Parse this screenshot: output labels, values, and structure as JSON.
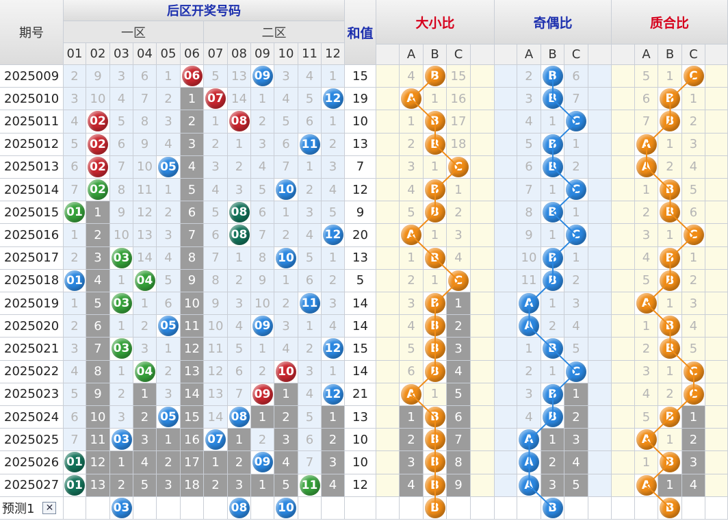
{
  "header": {
    "period_label": "期号",
    "draw_title": "后区开奖号码",
    "zone1_label": "一区",
    "zone2_label": "二区",
    "sum_label": "和值",
    "size_ratio_label": "大小比",
    "odd_even_label": "奇偶比",
    "prime_label": "质合比",
    "numbers": [
      "01",
      "02",
      "03",
      "04",
      "05",
      "06",
      "07",
      "08",
      "09",
      "10",
      "11",
      "12"
    ],
    "abc": [
      "A",
      "B",
      "C"
    ]
  },
  "colors": {
    "red_ball": "#c8272f",
    "blue_ball": "#2b87e0",
    "green_ball": "#36a13a",
    "dark_green_ball": "#137259",
    "orange_ball": "#f08c16",
    "gray_cell": "#9c9c9c",
    "line_orange": "#f08c16",
    "line_blue": "#2b87e0"
  },
  "rows": [
    {
      "period": "2025009",
      "cells": [
        "2",
        "9",
        "3",
        "6",
        "1",
        "06",
        "5",
        "13",
        "09",
        "3",
        "4",
        "1"
      ],
      "hits": {
        "6": "red",
        "9": "blue"
      },
      "gray": [],
      "sum": "15",
      "size": [
        "4",
        "B",
        "15"
      ],
      "size_hit": 1,
      "size_gray": [],
      "oe": [
        "2",
        "B",
        "6"
      ],
      "oe_hit": 1,
      "oe_gray": [],
      "pc": [
        "5",
        "1",
        "C"
      ],
      "pc_hit": 2,
      "pc_gray": []
    },
    {
      "period": "2025010",
      "cells": [
        "3",
        "10",
        "4",
        "7",
        "2",
        "1",
        "07",
        "14",
        "1",
        "4",
        "5",
        "12"
      ],
      "hits": {
        "7": "red",
        "12": "blue"
      },
      "gray": [
        6
      ],
      "sum": "19",
      "size": [
        "A",
        "1",
        "16"
      ],
      "size_hit": 0,
      "size_gray": [],
      "oe": [
        "3",
        "B",
        "7"
      ],
      "oe_hit": 1,
      "oe_gray": [],
      "pc": [
        "6",
        "B",
        "1"
      ],
      "pc_hit": 1,
      "pc_gray": []
    },
    {
      "period": "2025011",
      "cells": [
        "4",
        "02",
        "5",
        "8",
        "3",
        "2",
        "1",
        "08",
        "2",
        "5",
        "6",
        "1"
      ],
      "hits": {
        "2": "red",
        "8": "red"
      },
      "gray": [
        6
      ],
      "sum": "10",
      "size": [
        "1",
        "B",
        "17"
      ],
      "size_hit": 1,
      "size_gray": [],
      "oe": [
        "4",
        "1",
        "C"
      ],
      "oe_hit": 2,
      "oe_gray": [],
      "pc": [
        "7",
        "B",
        "2"
      ],
      "pc_hit": 1,
      "pc_gray": []
    },
    {
      "period": "2025012",
      "cells": [
        "5",
        "02",
        "6",
        "9",
        "4",
        "3",
        "2",
        "1",
        "3",
        "6",
        "11",
        "2"
      ],
      "hits": {
        "2": "red",
        "11": "blue"
      },
      "gray": [
        6
      ],
      "sum": "13",
      "size": [
        "2",
        "B",
        "18"
      ],
      "size_hit": 1,
      "size_gray": [],
      "oe": [
        "5",
        "B",
        "1"
      ],
      "oe_hit": 1,
      "oe_gray": [],
      "pc": [
        "A",
        "1",
        "3"
      ],
      "pc_hit": 0,
      "pc_gray": []
    },
    {
      "period": "2025013",
      "cells": [
        "6",
        "02",
        "7",
        "10",
        "05",
        "4",
        "3",
        "2",
        "4",
        "7",
        "1",
        "3"
      ],
      "hits": {
        "2": "red",
        "5": "blue"
      },
      "gray": [
        6
      ],
      "sum": "7",
      "size": [
        "3",
        "1",
        "C"
      ],
      "size_hit": 2,
      "size_gray": [],
      "oe": [
        "6",
        "B",
        "2"
      ],
      "oe_hit": 1,
      "oe_gray": [],
      "pc": [
        "A",
        "2",
        "4"
      ],
      "pc_hit": 0,
      "pc_gray": []
    },
    {
      "period": "2025014",
      "cells": [
        "7",
        "02",
        "8",
        "11",
        "1",
        "5",
        "4",
        "3",
        "5",
        "10",
        "2",
        "4"
      ],
      "hits": {
        "2": "green",
        "10": "blue"
      },
      "gray": [
        6
      ],
      "sum": "12",
      "size": [
        "4",
        "B",
        "1"
      ],
      "size_hit": 1,
      "size_gray": [],
      "oe": [
        "7",
        "1",
        "C"
      ],
      "oe_hit": 2,
      "oe_gray": [],
      "pc": [
        "1",
        "B",
        "5"
      ],
      "pc_hit": 1,
      "pc_gray": []
    },
    {
      "period": "2025015",
      "cells": [
        "01",
        "1",
        "9",
        "12",
        "2",
        "6",
        "5",
        "08",
        "6",
        "1",
        "3",
        "5"
      ],
      "hits": {
        "1": "green",
        "8": "dgreen"
      },
      "gray": [
        2,
        6
      ],
      "sum": "9",
      "size": [
        "5",
        "B",
        "2"
      ],
      "size_hit": 1,
      "size_gray": [],
      "oe": [
        "8",
        "B",
        "1"
      ],
      "oe_hit": 1,
      "oe_gray": [],
      "pc": [
        "2",
        "B",
        "6"
      ],
      "pc_hit": 1,
      "pc_gray": []
    },
    {
      "period": "2025016",
      "cells": [
        "1",
        "2",
        "10",
        "13",
        "3",
        "7",
        "6",
        "08",
        "7",
        "2",
        "4",
        "12"
      ],
      "hits": {
        "8": "dgreen",
        "12": "blue"
      },
      "gray": [
        2,
        6
      ],
      "sum": "20",
      "size": [
        "A",
        "1",
        "3"
      ],
      "size_hit": 0,
      "size_gray": [],
      "oe": [
        "9",
        "1",
        "C"
      ],
      "oe_hit": 2,
      "oe_gray": [],
      "pc": [
        "3",
        "1",
        "C"
      ],
      "pc_hit": 2,
      "pc_gray": []
    },
    {
      "period": "2025017",
      "cells": [
        "2",
        "3",
        "03",
        "14",
        "4",
        "8",
        "7",
        "1",
        "8",
        "10",
        "5",
        "1"
      ],
      "hits": {
        "3": "green",
        "10": "blue"
      },
      "gray": [
        2,
        6
      ],
      "sum": "13",
      "size": [
        "1",
        "B",
        "4"
      ],
      "size_hit": 1,
      "size_gray": [],
      "oe": [
        "10",
        "B",
        "1"
      ],
      "oe_hit": 1,
      "oe_gray": [],
      "pc": [
        "4",
        "B",
        "1"
      ],
      "pc_hit": 1,
      "pc_gray": []
    },
    {
      "period": "2025018",
      "cells": [
        "01",
        "4",
        "1",
        "04",
        "5",
        "9",
        "8",
        "2",
        "9",
        "1",
        "6",
        "2"
      ],
      "hits": {
        "1": "blue",
        "4": "green"
      },
      "gray": [
        2,
        6
      ],
      "sum": "5",
      "size": [
        "2",
        "1",
        "C"
      ],
      "size_hit": 2,
      "size_gray": [],
      "oe": [
        "11",
        "B",
        "2"
      ],
      "oe_hit": 1,
      "oe_gray": [],
      "pc": [
        "5",
        "B",
        "2"
      ],
      "pc_hit": 1,
      "pc_gray": []
    },
    {
      "period": "2025019",
      "cells": [
        "1",
        "5",
        "03",
        "1",
        "6",
        "10",
        "9",
        "3",
        "10",
        "2",
        "11",
        "3"
      ],
      "hits": {
        "3": "green",
        "11": "blue"
      },
      "gray": [
        2,
        6
      ],
      "sum": "14",
      "size": [
        "3",
        "B",
        "1"
      ],
      "size_hit": 1,
      "size_gray": [
        2
      ],
      "oe": [
        "A",
        "1",
        "3"
      ],
      "oe_hit": 0,
      "oe_gray": [],
      "pc": [
        "A",
        "1",
        "3"
      ],
      "pc_hit": 0,
      "pc_gray": []
    },
    {
      "period": "2025020",
      "cells": [
        "2",
        "6",
        "1",
        "2",
        "05",
        "11",
        "10",
        "4",
        "09",
        "3",
        "1",
        "4"
      ],
      "hits": {
        "5": "blue",
        "9": "blue"
      },
      "gray": [
        2,
        6
      ],
      "sum": "14",
      "size": [
        "4",
        "B",
        "2"
      ],
      "size_hit": 1,
      "size_gray": [
        2
      ],
      "oe": [
        "A",
        "2",
        "4"
      ],
      "oe_hit": 0,
      "oe_gray": [],
      "pc": [
        "1",
        "B",
        "4"
      ],
      "pc_hit": 1,
      "pc_gray": []
    },
    {
      "period": "2025021",
      "cells": [
        "3",
        "7",
        "03",
        "3",
        "1",
        "12",
        "11",
        "5",
        "1",
        "4",
        "2",
        "12"
      ],
      "hits": {
        "3": "green",
        "12": "blue"
      },
      "gray": [
        2,
        6
      ],
      "sum": "15",
      "size": [
        "5",
        "B",
        "3"
      ],
      "size_hit": 1,
      "size_gray": [
        2
      ],
      "oe": [
        "1",
        "B",
        "5"
      ],
      "oe_hit": 1,
      "oe_gray": [],
      "pc": [
        "2",
        "B",
        "5"
      ],
      "pc_hit": 1,
      "pc_gray": []
    },
    {
      "period": "2025022",
      "cells": [
        "4",
        "8",
        "1",
        "04",
        "2",
        "13",
        "12",
        "6",
        "2",
        "10",
        "3",
        "1"
      ],
      "hits": {
        "4": "green",
        "10": "red"
      },
      "gray": [
        2,
        6
      ],
      "sum": "14",
      "size": [
        "6",
        "B",
        "4"
      ],
      "size_hit": 1,
      "size_gray": [
        2
      ],
      "oe": [
        "2",
        "1",
        "C"
      ],
      "oe_hit": 2,
      "oe_gray": [],
      "pc": [
        "3",
        "1",
        "C"
      ],
      "pc_hit": 2,
      "pc_gray": []
    },
    {
      "period": "2025023",
      "cells": [
        "5",
        "9",
        "2",
        "1",
        "3",
        "14",
        "13",
        "7",
        "09",
        "1",
        "4",
        "12"
      ],
      "hits": {
        "9": "red",
        "12": "blue"
      },
      "gray": [
        2,
        4,
        6,
        10
      ],
      "sum": "21",
      "size": [
        "A",
        "1",
        "5"
      ],
      "size_hit": 0,
      "size_gray": [
        2
      ],
      "oe": [
        "3",
        "B",
        "1"
      ],
      "oe_hit": 1,
      "oe_gray": [
        2
      ],
      "pc": [
        "4",
        "2",
        "C"
      ],
      "pc_hit": 2,
      "pc_gray": []
    },
    {
      "period": "2025024",
      "cells": [
        "6",
        "10",
        "3",
        "2",
        "05",
        "15",
        "14",
        "08",
        "1",
        "2",
        "5",
        "1"
      ],
      "hits": {
        "5": "blue",
        "8": "blue"
      },
      "gray": [
        2,
        4,
        6,
        9,
        10,
        12
      ],
      "sum": "13",
      "size": [
        "1",
        "B",
        "6"
      ],
      "size_hit": 1,
      "size_gray": [
        0,
        2
      ],
      "oe": [
        "4",
        "B",
        "2"
      ],
      "oe_hit": 1,
      "oe_gray": [
        2
      ],
      "pc": [
        "5",
        "B",
        "1"
      ],
      "pc_hit": 1,
      "pc_gray": [
        2
      ]
    },
    {
      "period": "2025025",
      "cells": [
        "7",
        "11",
        "03",
        "3",
        "1",
        "16",
        "07",
        "1",
        "2",
        "3",
        "6",
        "2"
      ],
      "hits": {
        "3": "blue",
        "7": "blue"
      },
      "gray": [
        2,
        4,
        5,
        6,
        8,
        10,
        12
      ],
      "sum": "10",
      "size": [
        "2",
        "B",
        "7"
      ],
      "size_hit": 1,
      "size_gray": [
        0,
        2
      ],
      "oe": [
        "A",
        "1",
        "3"
      ],
      "oe_hit": 0,
      "oe_gray": [
        1,
        2
      ],
      "pc": [
        "A",
        "1",
        "2"
      ],
      "pc_hit": 0,
      "pc_gray": [
        2
      ]
    },
    {
      "period": "2025026",
      "cells": [
        "01",
        "12",
        "1",
        "4",
        "2",
        "17",
        "1",
        "2",
        "09",
        "4",
        "7",
        "3"
      ],
      "hits": {
        "1": "dgreen",
        "9": "blue"
      },
      "gray": [
        2,
        3,
        4,
        5,
        6,
        7,
        8,
        10,
        12
      ],
      "sum": "10",
      "size": [
        "3",
        "B",
        "8"
      ],
      "size_hit": 1,
      "size_gray": [
        0,
        2
      ],
      "oe": [
        "A",
        "2",
        "4"
      ],
      "oe_hit": 0,
      "oe_gray": [
        1,
        2
      ],
      "pc": [
        "1",
        "B",
        "3"
      ],
      "pc_hit": 1,
      "pc_gray": [
        2
      ]
    },
    {
      "period": "2025027",
      "cells": [
        "01",
        "13",
        "2",
        "5",
        "3",
        "18",
        "2",
        "3",
        "1",
        "5",
        "11",
        "4"
      ],
      "hits": {
        "1": "dgreen",
        "11": "green"
      },
      "gray": [
        2,
        3,
        4,
        5,
        6,
        7,
        8,
        9,
        10,
        12
      ],
      "sum": "12",
      "size": [
        "4",
        "B",
        "9"
      ],
      "size_hit": 1,
      "size_gray": [
        0,
        2
      ],
      "oe": [
        "A",
        "3",
        "5"
      ],
      "oe_hit": 0,
      "oe_gray": [
        1,
        2
      ],
      "pc": [
        "A",
        "1",
        "4"
      ],
      "pc_hit": 0,
      "pc_gray": [
        1,
        2
      ]
    }
  ],
  "forecast": {
    "label": "预测1",
    "close_glyph": "✕",
    "balls": {
      "3": "03",
      "8": "08",
      "10": "10"
    },
    "size": "B",
    "oe": "B",
    "pc": "B"
  }
}
